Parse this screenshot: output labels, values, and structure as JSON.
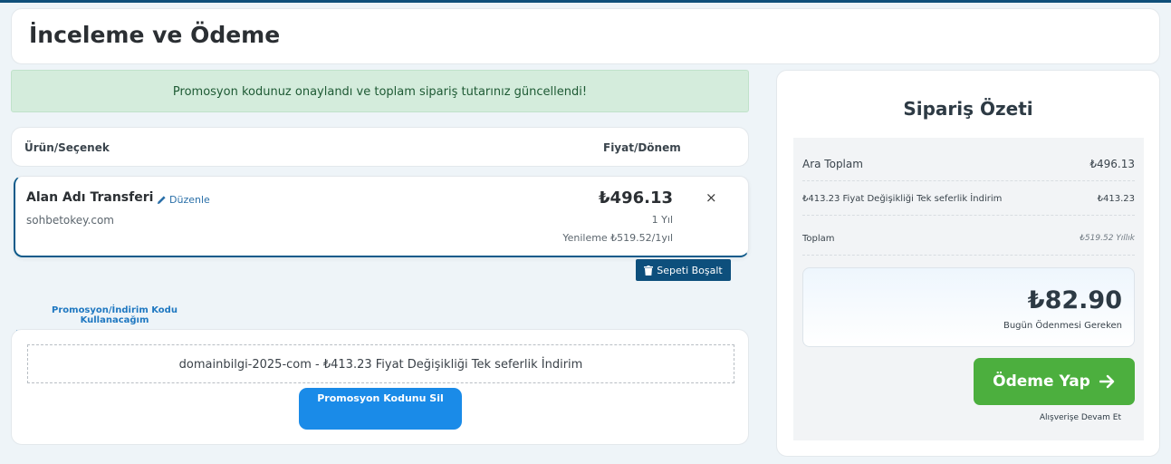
{
  "page": {
    "title": "İnceleme ve Ödeme"
  },
  "alert": {
    "message": "Promosyon kodunuz onaylandı ve toplam sipariş tutarınız güncellendi!"
  },
  "cart": {
    "headers": {
      "product": "Ürün/Seçenek",
      "price": "Fiyat/Dönem"
    },
    "items": [
      {
        "name": "Alan Adı Transferi",
        "edit_label": "Düzenle",
        "domain": "sohbetokey.com",
        "price": "₺496.13",
        "period": "1 Yıl",
        "renewal": "Yenileme ₺519.52/1yıl",
        "remove_icon": "×"
      }
    ],
    "empty_cart_label": "Sepeti Boşalt"
  },
  "promo": {
    "tab_label": "Promosyon/İndirim Kodu Kullanacağım",
    "applied_code": "domainbilgi-2025-com - ₺413.23 Fiyat Değişikliği Tek seferlik İndirim",
    "remove_label": "Promosyon Kodunu Sil"
  },
  "summary": {
    "title": "Sipariş Özeti",
    "rows": [
      {
        "label": "Ara Toplam",
        "value": "₺496.13"
      },
      {
        "label": "₺413.23 Fiyat Değişikliği Tek seferlik İndirim",
        "value": "₺413.23"
      },
      {
        "label": "Toplam",
        "value": "₺519.52 Yıllık"
      }
    ],
    "total_amount": "₺82.90",
    "total_label": "Bugün Ödenmesi Gereken",
    "pay_label": "Ödeme Yap",
    "continue_label": "Alışverişe Devam Et"
  },
  "colors": {
    "primary": "#0d4f7c",
    "success_button": "#4caf3e",
    "promo_button": "#1a8be8",
    "alert_bg": "#d4ecdc"
  },
  "icons": {
    "edit": "pencil-icon",
    "trash": "trash-icon",
    "close": "close-icon",
    "arrow": "arrow-right-icon"
  }
}
